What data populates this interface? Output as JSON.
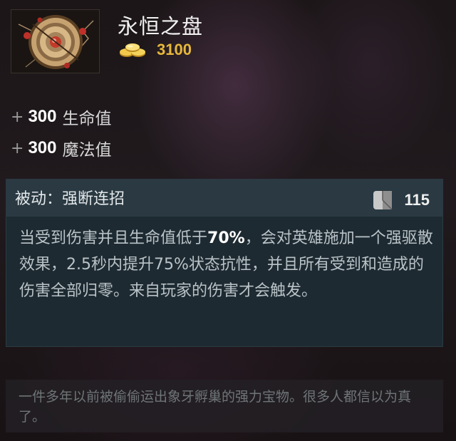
{
  "item": {
    "name": "永恒之盘",
    "icon": "aeon-disk-icon",
    "cost": "3100",
    "cost_icon": "gold-coins-icon"
  },
  "stats": [
    {
      "sign": "+",
      "value": "300",
      "label": "生命值"
    },
    {
      "sign": "+",
      "value": "300",
      "label": "魔法值"
    }
  ],
  "ability": {
    "title": "被动：强断连招",
    "cooldown": "115",
    "cooldown_icon": "cooldown-icon",
    "desc_before": "当受到伤害并且生命值低于",
    "desc_highlight": "70%",
    "desc_after": "，会对英雄施加一个强驱散效果，2.5秒内提升75%状态抗性，并且所有受到和造成的伤害全部归零。来自玩家的伤害才会触发。"
  },
  "lore": "一件多年以前被偷偷运出象牙孵巢的强力宝物。很多人都信以为真了。",
  "colors": {
    "gold": "#e7b83a",
    "ability_header": "#2a3942",
    "ability_body": "#1e2a31",
    "lore_text": "#6f7577"
  }
}
